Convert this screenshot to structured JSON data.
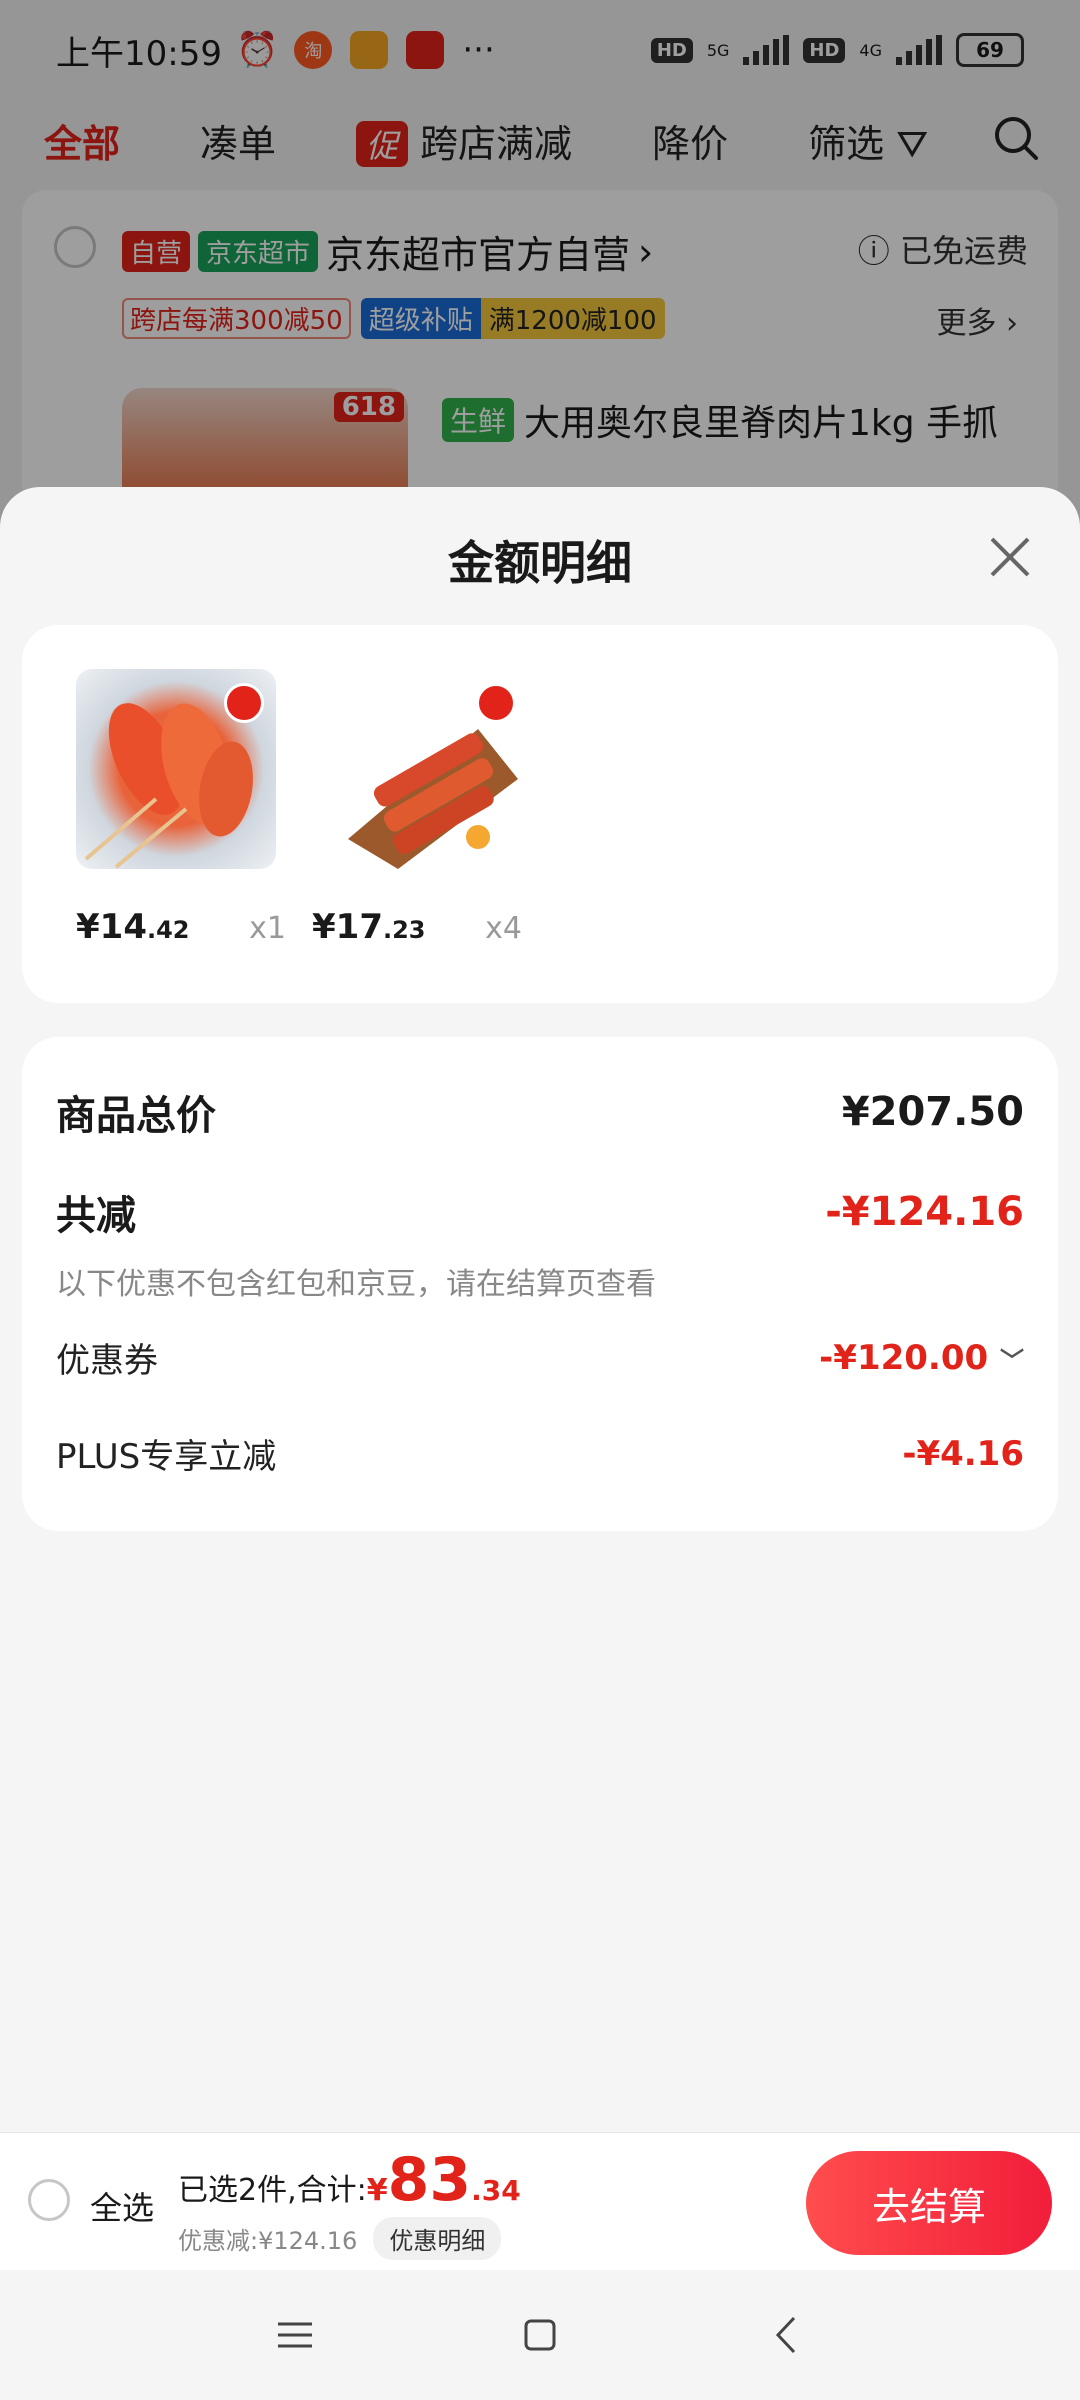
{
  "status_bar": {
    "time": "上午10:59",
    "battery": "69",
    "hd_label": "HD",
    "net1": "5G",
    "net2": "4G",
    "more": "···"
  },
  "top_tabs": {
    "all": "全部",
    "bundle": "凑单",
    "promo_tag": "促",
    "cross_store": "跨店满减",
    "price_drop": "降价",
    "filter": "筛选"
  },
  "store": {
    "tag_self": "自营",
    "tag_market": "京东超市",
    "name": "京东超市官方自营",
    "chevron": "›",
    "free_shipping": "已免运费",
    "promo1": "跨店每满300减50",
    "promo2": "超级补贴",
    "promo3": "满1200减100",
    "more": "更多 ›",
    "badge_618": "618",
    "fresh_tag": "生鲜",
    "product_title": "大用奥尔良里脊肉片1kg 手抓"
  },
  "sheet": {
    "title": "金额明细"
  },
  "goods": [
    {
      "price_int": "¥14",
      "price_dec": ".42",
      "qty": "x1"
    },
    {
      "price_int": "¥17",
      "price_dec": ".23",
      "qty": "x4"
    }
  ],
  "details": {
    "total_label": "商品总价",
    "total_value": "¥207.50",
    "discount_label": "共减",
    "discount_value": "-¥124.16",
    "note": "以下优惠不包含红包和京豆，请在结算页查看",
    "coupon_label": "优惠券",
    "coupon_value": "-¥120.00",
    "coupon_chevron": "﹀",
    "plus_label": "PLUS专享立减",
    "plus_value": "-¥4.16"
  },
  "bottom": {
    "select_all": "全选",
    "selected_text": "已选2件,合计:",
    "currency": "¥",
    "total_int": "83",
    "total_dec": ".34",
    "discount_text": "优惠减:¥124.16",
    "detail_pill": "优惠明细",
    "checkout": "去结算"
  },
  "colors": {
    "accent": "#e2231a",
    "checkout_gradient_start": "#ff4d4d",
    "checkout_gradient_end": "#f21d3a"
  }
}
